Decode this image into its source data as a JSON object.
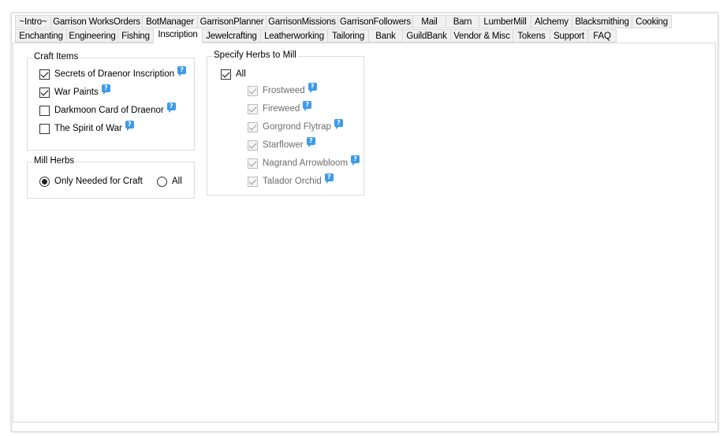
{
  "tabs_row1": [
    "~Intro~",
    "Garrison WorksOrders",
    "BotManager",
    "GarrisonPlanner",
    "GarrisonMissions",
    "GarrisonFollowers",
    "Mail",
    "Barn",
    "LumberMill",
    "Alchemy",
    "Blacksmithing",
    "Cooking"
  ],
  "tabs_row2": [
    "Enchanting",
    "Engineering",
    "Fishing",
    "Inscription",
    "Jewelcrafting",
    "Leatherworking",
    "Tailoring",
    "Bank",
    "GuildBank",
    "Vendor & Misc",
    "Tokens",
    "Support",
    "FAQ"
  ],
  "active_tab": "Inscription",
  "help_glyph": "?",
  "craft_items": {
    "title": "Craft Items",
    "items": [
      {
        "label": "Secrets of Draenor Inscription",
        "checked": true
      },
      {
        "label": "War Paints",
        "checked": true
      },
      {
        "label": "Darkmoon Card of Draenor",
        "checked": false
      },
      {
        "label": "The Spirit of War",
        "checked": false
      }
    ]
  },
  "mill_herbs": {
    "title": "Mill Herbs",
    "options": [
      {
        "label": "Only Needed for Craft",
        "selected": true
      },
      {
        "label": "All",
        "selected": false
      }
    ]
  },
  "specify_herbs": {
    "title": "Specify Herbs to Mill",
    "all": {
      "label": "All",
      "checked": true
    },
    "herbs": [
      {
        "label": "Frostweed",
        "checked": true
      },
      {
        "label": "Fireweed",
        "checked": true
      },
      {
        "label": "Gorgrond Flytrap",
        "checked": true
      },
      {
        "label": "Starflower",
        "checked": true
      },
      {
        "label": "Nagrand Arrowbloom",
        "checked": true
      },
      {
        "label": "Talador Orchid",
        "checked": true
      }
    ]
  },
  "colors": {
    "help_icon": "#3d9be8",
    "tab_bg": "#f0f0f0",
    "border": "#d9d9d9"
  }
}
